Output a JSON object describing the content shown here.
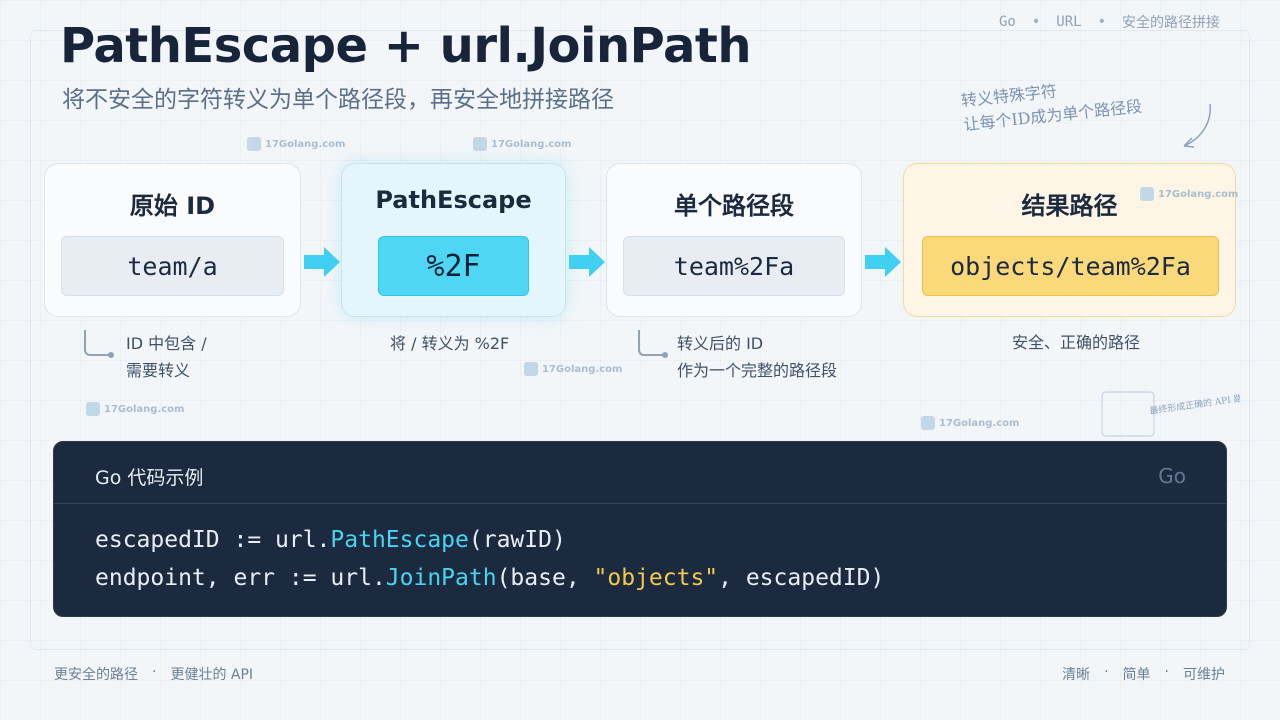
{
  "header": {
    "title": "PathEscape + url.JoinPath",
    "subtitle": "将不安全的字符转义为单个路径段，再安全地拼接路径"
  },
  "topnav": {
    "items": [
      "Go",
      "URL",
      "安全的路径拼接"
    ]
  },
  "handnote": {
    "line1": "转义特殊字符",
    "line2": "让每个ID成为单个路径段",
    "corner": "最终形成正确的 API 路径"
  },
  "steps": [
    {
      "title": "原始 ID",
      "value": "team/a",
      "caption1": "ID 中包含 /",
      "caption2": "需要转义"
    },
    {
      "title": "PathEscape",
      "value": "%2F",
      "caption1": "将 / 转义为 %2F",
      "caption2": ""
    },
    {
      "title": "单个路径段",
      "value": "team%2Fa",
      "caption1": "转义后的 ID",
      "caption2": "作为一个完整的路径段"
    },
    {
      "title": "结果路径",
      "value": "objects/team%2Fa",
      "caption1": "安全、正确的路径",
      "caption2": ""
    }
  ],
  "code": {
    "label": "Go 代码示例",
    "lang": "Go",
    "line1": {
      "a": "escapedID := url.",
      "fn": "PathEscape",
      "b": "(rawID)"
    },
    "line2": {
      "a": "endpoint, err := url.",
      "fn": "JoinPath",
      "b": "(base, ",
      "str": "\"objects\"",
      "c": ", escapedID)"
    }
  },
  "footer": {
    "left": [
      "更安全的路径",
      "·",
      "更健壮的 API"
    ],
    "right": [
      "清晰",
      "·",
      "简单",
      "·",
      "可维护"
    ]
  },
  "watermark": "17Golang.com",
  "colors": {
    "accent": "#49d4f2",
    "highlight": "#fbd97a",
    "code_bg": "#1c2a3f"
  }
}
